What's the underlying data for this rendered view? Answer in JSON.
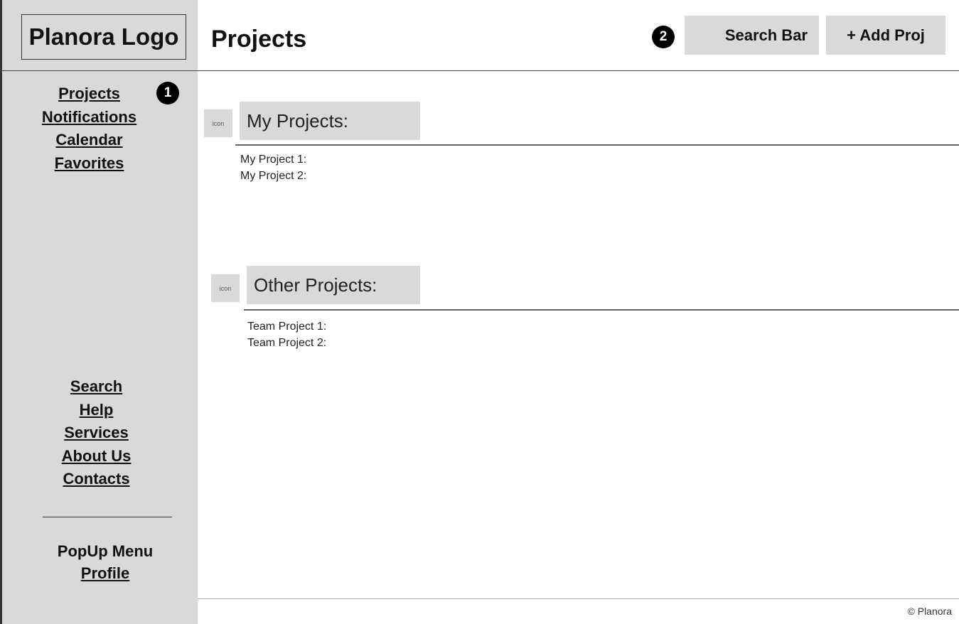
{
  "logo": {
    "text": "Planora Logo"
  },
  "header": {
    "title": "Projects",
    "search_label": "Search Bar",
    "add_label": "+ Add Proj"
  },
  "markers": [
    "1",
    "2"
  ],
  "sidebar": {
    "top_items": [
      {
        "label": "Projects"
      },
      {
        "label": "Notifications"
      },
      {
        "label": "Calendar"
      },
      {
        "label": "Favorites"
      }
    ],
    "bottom_items": [
      {
        "label": "Search"
      },
      {
        "label": "Help"
      },
      {
        "label": "Services"
      },
      {
        "label": "About Us"
      },
      {
        "label": "Contacts"
      }
    ],
    "popup_label": "PopUp Menu",
    "profile_label": "Profile"
  },
  "sections": {
    "my_projects": {
      "icon_label": "icon",
      "title": "My Projects:",
      "items": [
        "My Project 1:",
        "My Project 2:"
      ]
    },
    "other_projects": {
      "icon_label": "icon",
      "title": "Other Projects:",
      "items": [
        "Team Project 1:",
        "Team Project 2:"
      ]
    }
  },
  "footer": {
    "text": "© Planora"
  }
}
